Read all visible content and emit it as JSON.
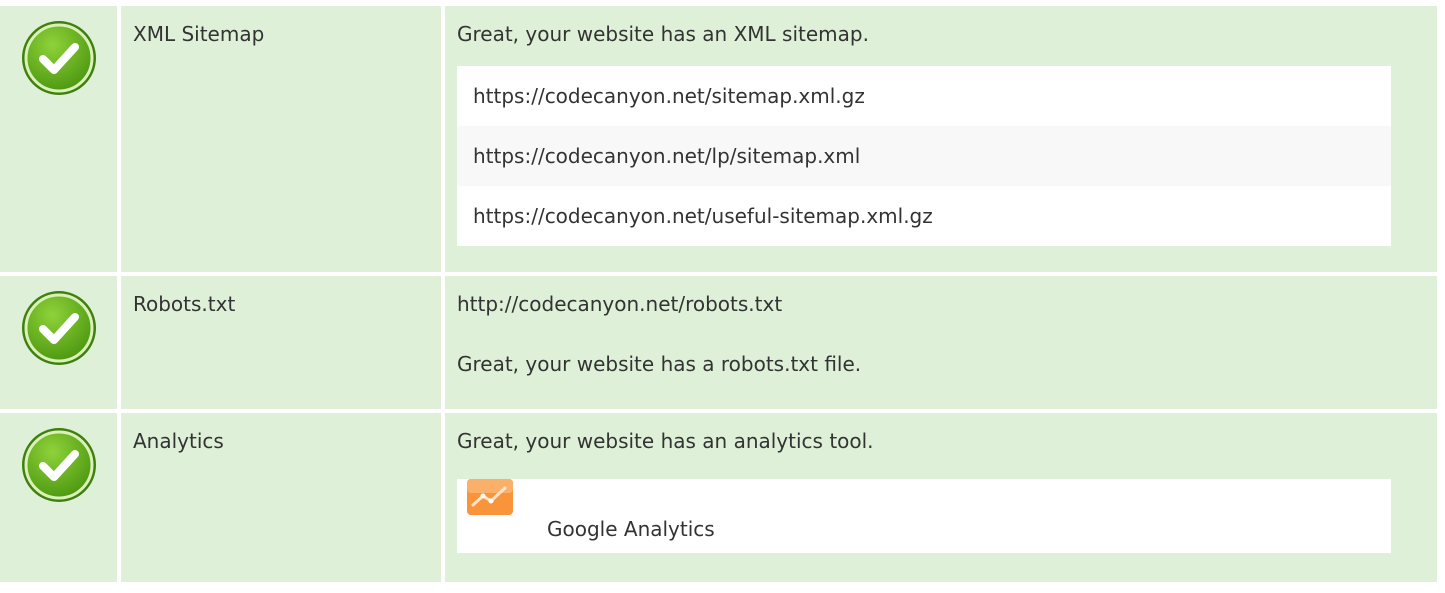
{
  "colors": {
    "success_bg": "#dff0d8",
    "check_green": "#6cb820",
    "list_bg": "#ffffff",
    "list_alt_bg": "#f8f8f8",
    "analytics_orange": "#f9943b"
  },
  "rows": [
    {
      "status_icon": "check-circle-icon",
      "name": "XML Sitemap",
      "message": "Great, your website has an XML sitemap.",
      "sitemaps": [
        "https://codecanyon.net/sitemap.xml.gz",
        "https://codecanyon.net/lp/sitemap.xml",
        "https://codecanyon.net/useful-sitemap.xml.gz"
      ]
    },
    {
      "status_icon": "check-circle-icon",
      "name": "Robots.txt",
      "url": "http://codecanyon.net/robots.txt",
      "message": "Great, your website has a robots.txt file."
    },
    {
      "status_icon": "check-circle-icon",
      "name": "Analytics",
      "message": "Great, your website has an analytics tool.",
      "tools": [
        {
          "icon": "google-analytics-icon",
          "name": "Google Analytics"
        }
      ]
    }
  ]
}
